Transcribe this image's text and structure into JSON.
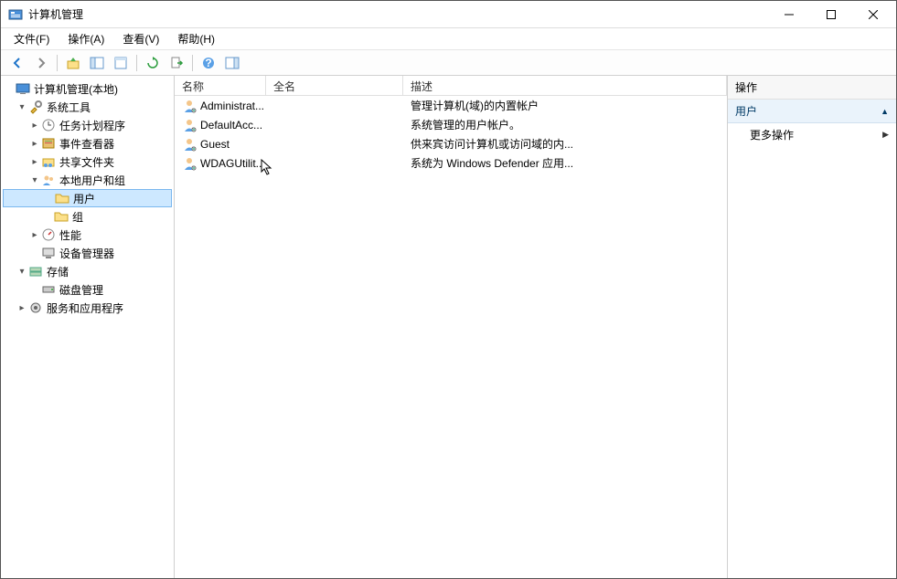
{
  "window": {
    "title": "计算机管理"
  },
  "menu": {
    "file": "文件(F)",
    "action": "操作(A)",
    "view": "查看(V)",
    "help": "帮助(H)"
  },
  "tree": {
    "root": "计算机管理(本地)",
    "system_tools": "系统工具",
    "task_scheduler": "任务计划程序",
    "event_viewer": "事件查看器",
    "shared_folders": "共享文件夹",
    "local_users_groups": "本地用户和组",
    "users": "用户",
    "groups": "组",
    "performance": "性能",
    "device_manager": "设备管理器",
    "storage": "存储",
    "disk_management": "磁盘管理",
    "services_apps": "服务和应用程序"
  },
  "columns": {
    "name": "名称",
    "full_name": "全名",
    "description": "描述"
  },
  "users": [
    {
      "name": "Administrat...",
      "full": "",
      "desc": "管理计算机(域)的内置帐户"
    },
    {
      "name": "DefaultAcc...",
      "full": "",
      "desc": "系统管理的用户帐户。"
    },
    {
      "name": "Guest",
      "full": "",
      "desc": "供来宾访问计算机或访问域的内..."
    },
    {
      "name": "WDAGUtilit...",
      "full": "",
      "desc": "系统为 Windows Defender 应用..."
    }
  ],
  "actions": {
    "title": "操作",
    "section": "用户",
    "more": "更多操作"
  }
}
